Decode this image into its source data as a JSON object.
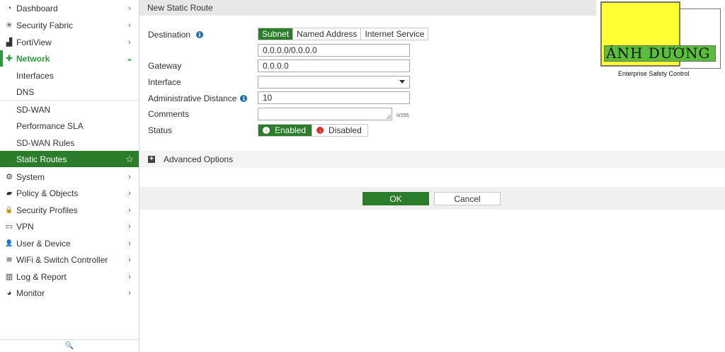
{
  "sidebar": {
    "items": [
      {
        "label": "Dashboard",
        "icon": "dashboard-icon",
        "glyph": "◔"
      },
      {
        "label": "Security Fabric",
        "icon": "security-fabric-icon",
        "glyph": "✳"
      },
      {
        "label": "FortiView",
        "icon": "fortiview-icon",
        "glyph": "▟"
      },
      {
        "label": "Network",
        "icon": "network-icon",
        "glyph": "✚"
      },
      {
        "label": "Interfaces"
      },
      {
        "label": "DNS"
      },
      {
        "label": "SD-WAN"
      },
      {
        "label": "Performance SLA"
      },
      {
        "label": "SD-WAN Rules"
      },
      {
        "label": "Static Routes"
      },
      {
        "label": "System",
        "icon": "gear-icon",
        "glyph": "⚙"
      },
      {
        "label": "Policy & Objects",
        "icon": "policy-icon",
        "glyph": "▰"
      },
      {
        "label": "Security Profiles",
        "icon": "lock-icon",
        "glyph": "🔒"
      },
      {
        "label": "VPN",
        "icon": "laptop-icon",
        "glyph": "▭"
      },
      {
        "label": "User & Device",
        "icon": "user-icon",
        "glyph": "👤"
      },
      {
        "label": "WiFi & Switch Controller",
        "icon": "wifi-icon",
        "glyph": "≋"
      },
      {
        "label": "Log & Report",
        "icon": "chart-icon",
        "glyph": "▥"
      },
      {
        "label": "Monitor",
        "icon": "monitor-pie-icon",
        "glyph": "◕"
      }
    ],
    "chevron": "›",
    "chevron_open": "⌄",
    "star": "☆",
    "search_glyph": "🔍"
  },
  "header": {
    "title": "New Static Route"
  },
  "form": {
    "destination_label": "Destination",
    "info_glyph": "i",
    "destination_types": [
      "Subnet",
      "Named Address",
      "Internet Service"
    ],
    "destination_value": "0.0.0.0/0.0.0.0",
    "gateway_label": "Gateway",
    "gateway_value": "0.0.0.0",
    "interface_label": "Interface",
    "interface_value": "",
    "admin_distance_label": "Administrative Distance",
    "admin_distance_value": "10",
    "comments_label": "Comments",
    "comments_counter": "0/255",
    "status_label": "Status",
    "status_enabled": "Enabled",
    "status_disabled": "Disabled",
    "enabled_glyph": "↑",
    "disabled_glyph": "↓"
  },
  "advanced": {
    "label": "Advanced Options",
    "glyph": "+"
  },
  "buttons": {
    "ok": "OK",
    "cancel": "Cancel"
  },
  "logo": {
    "title": "ÁNH DƯƠNG",
    "subtitle": "Enterprise Safety Control"
  },
  "colors": {
    "accent": "#2b7d2b",
    "network_green": "#2d9c3f",
    "logo_yellow": "#ffff33",
    "logo_green": "#59bf3b"
  }
}
